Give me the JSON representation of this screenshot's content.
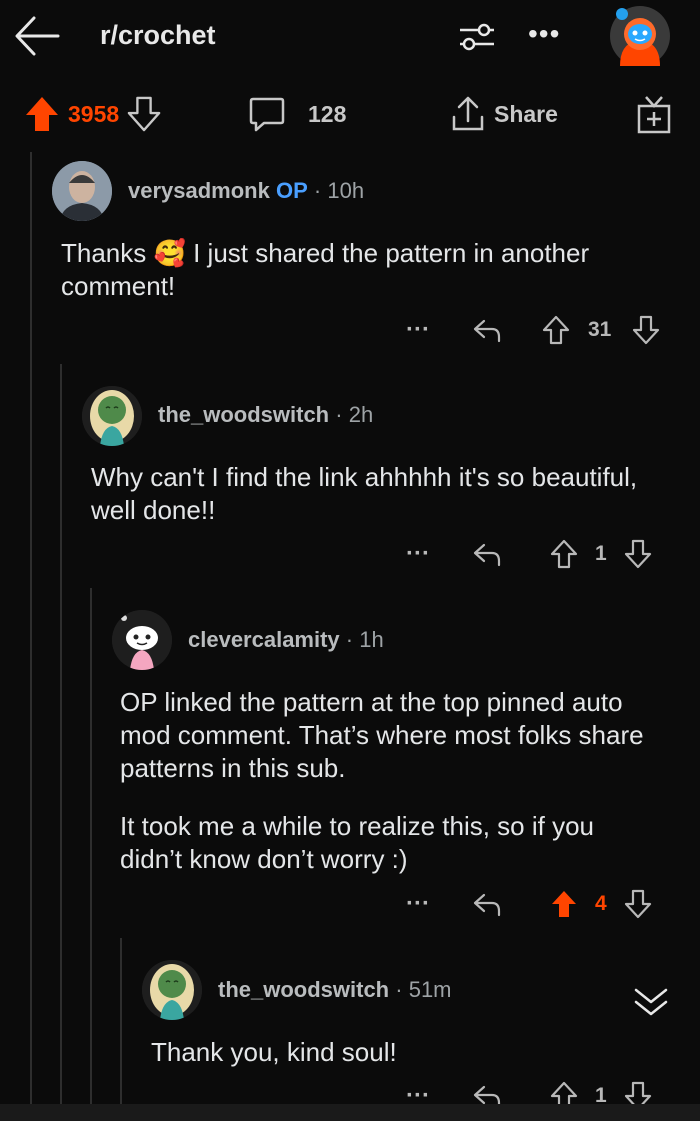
{
  "header": {
    "subreddit": "r/crochet"
  },
  "post_bar": {
    "score": "3958",
    "comments": "128",
    "share_label": "Share"
  },
  "comments": [
    {
      "user": "verysadmonk",
      "badge": "OP",
      "sep": "·",
      "time": "10h",
      "text_before": "Thanks",
      "emoji": "🥰",
      "text_after": "I just shared the pattern in another comment!",
      "more": "···",
      "score": "31"
    },
    {
      "user": "the_woodswitch",
      "sep": "·",
      "time": "2h",
      "text": "Why can't I find the link ahhhhh it's so beautiful, well done!!",
      "more": "···",
      "score": "1"
    },
    {
      "user": "clevercalamity",
      "sep": "·",
      "time": "1h",
      "para1": "OP linked the pattern at the top pinned auto mod comment. That’s where most folks share patterns in this sub.",
      "para2": "It took me a while to realize this, so if you didn’t know don’t worry :)",
      "more": "···",
      "score": "4",
      "upvoted": true
    },
    {
      "user": "the_woodswitch",
      "sep": "·",
      "time": "51m",
      "text": "Thank you, kind soul!",
      "more": "···",
      "score": "1"
    }
  ],
  "colors": {
    "accent": "#ff4500",
    "op": "#4a9fff",
    "background": "#0b0b0b"
  }
}
